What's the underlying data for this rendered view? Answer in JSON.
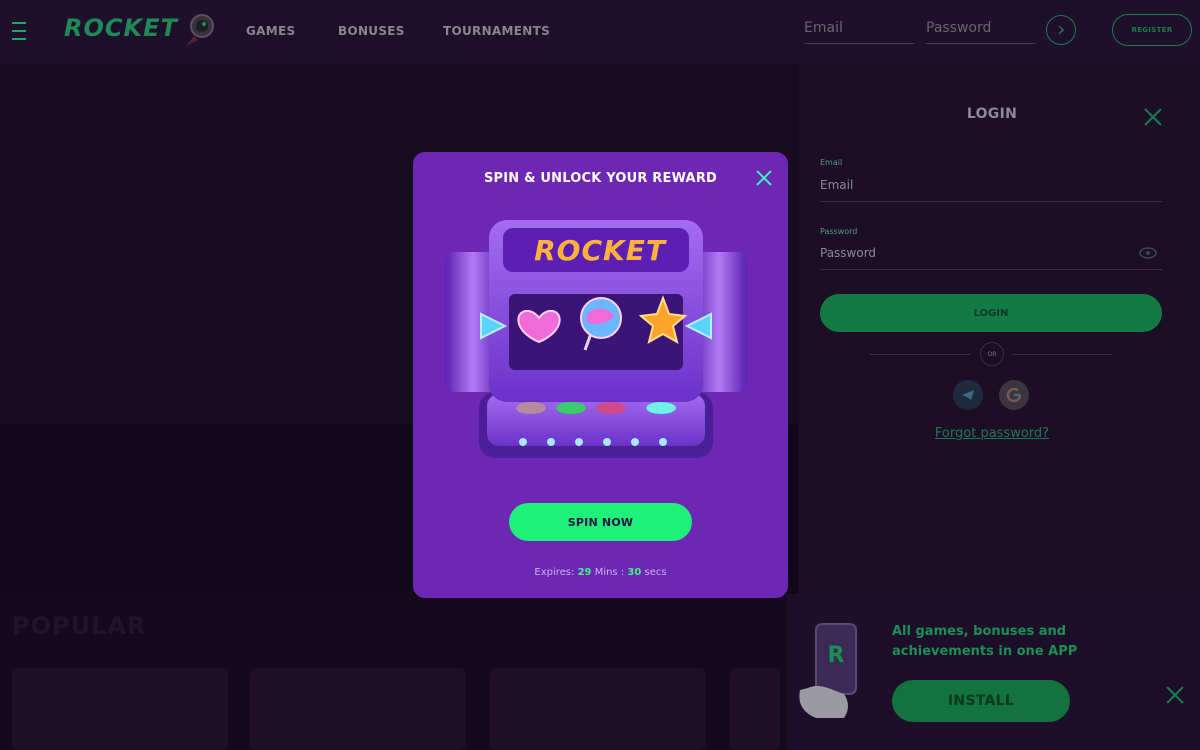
{
  "header": {
    "logo": "ROCKET",
    "nav": [
      "GAMES",
      "BONUSES",
      "TOURNAMENTS"
    ],
    "email_placeholder": "Email",
    "password_placeholder": "Password",
    "go_icon": "chevron-right-icon",
    "register_label": "REGISTER"
  },
  "background": {
    "popular_heading": "POPULAR"
  },
  "login": {
    "title": "LOGIN",
    "email_label": "Email",
    "email_placeholder": "Email",
    "password_label": "Password",
    "password_placeholder": "Password",
    "button_label": "LOGIN",
    "or_label": "OR",
    "socials": [
      "telegram-icon",
      "google-icon"
    ],
    "forgot_label": "Forgot password?"
  },
  "install": {
    "text": "All games, bonuses and achievements in one APP",
    "button_label": "INSTALL"
  },
  "modal": {
    "title": "SPIN & UNLOCK YOUR REWARD",
    "machine_logo": "ROCKET",
    "symbols": [
      "heart-candy-icon",
      "lollipop-icon",
      "star-candy-icon"
    ],
    "button_label": "SPIN NOW",
    "expires_label": "Expires:",
    "minutes": "29",
    "minutes_unit": "Mins",
    "separator": ":",
    "seconds": "30",
    "seconds_unit": "secs"
  },
  "colors": {
    "modal_bg": "#6e26b5",
    "accent_green": "#1ef07a",
    "page_bg": "#140a1c"
  }
}
